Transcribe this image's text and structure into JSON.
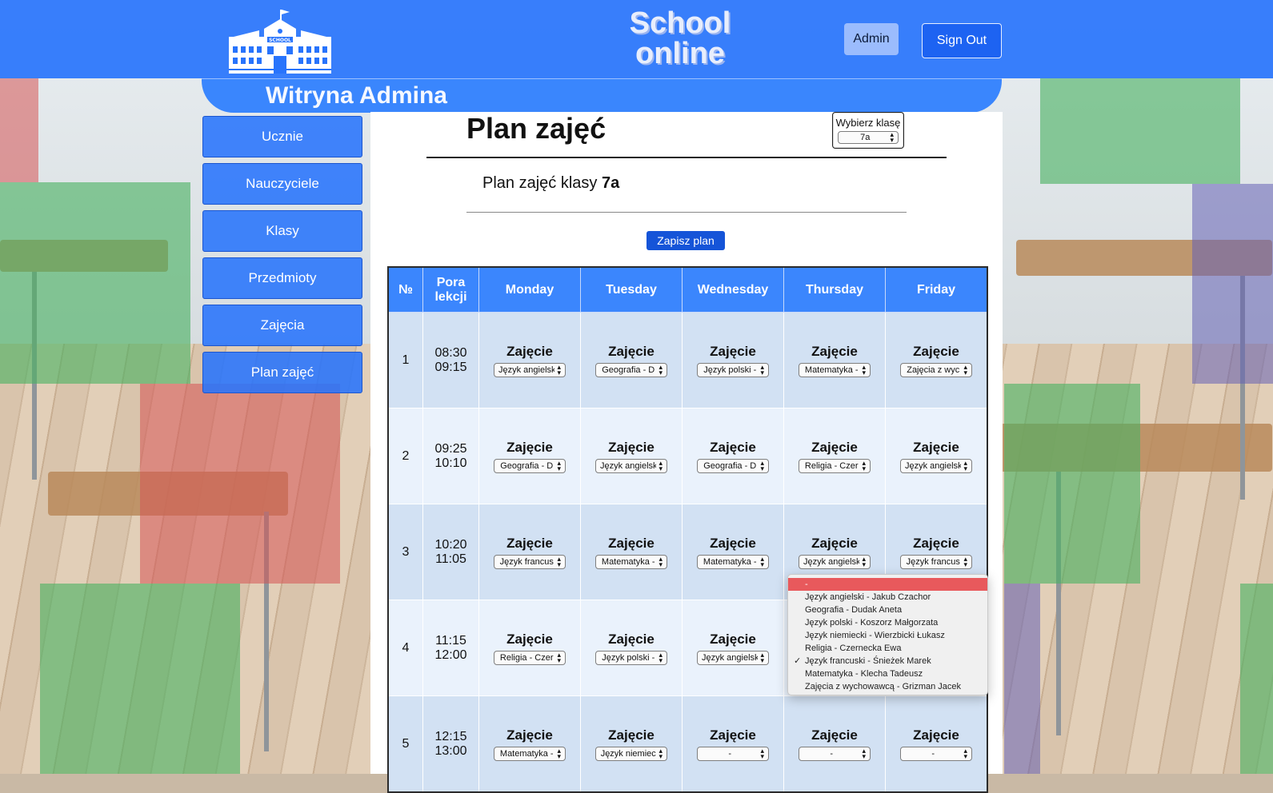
{
  "header": {
    "brand_line1": "School",
    "brand_line2": "online",
    "admin_label": "Admin",
    "signout_label": "Sign Out",
    "logo_sign": "SCHOOL"
  },
  "subbar": {
    "title": "Witryna Admina"
  },
  "nav": [
    "Ucznie",
    "Nauczyciele",
    "Klasy",
    "Przedmioty",
    "Zajęcia",
    "Plan zajęć"
  ],
  "main": {
    "title": "Plan zajęć",
    "class_select_label": "Wybierz klasę",
    "class_selected": "7a",
    "subtitle_prefix": "Plan zajęć klasy ",
    "subtitle_class": "7a",
    "save_label": "Zapisz plan"
  },
  "table": {
    "headers": [
      "№",
      "Pora lekcji",
      "Monday",
      "Tuesday",
      "Wednesday",
      "Thursday",
      "Friday"
    ],
    "cell_label": "Zajęcie",
    "rows": [
      {
        "num": "1",
        "start": "08:30",
        "end": "09:15",
        "cells": [
          "Język angielski",
          "Geografia - D",
          "Język polski -",
          "Matematyka -",
          "Zajęcia z wyc"
        ]
      },
      {
        "num": "2",
        "start": "09:25",
        "end": "10:10",
        "cells": [
          "Geografia - D",
          "Język angielski",
          "Geografia - D",
          "Religia - Czer",
          "Język angielski"
        ]
      },
      {
        "num": "3",
        "start": "10:20",
        "end": "11:05",
        "cells": [
          "Język francus",
          "Matematyka -",
          "Matematyka -",
          "Język angielski",
          "Język francus"
        ]
      },
      {
        "num": "4",
        "start": "11:15",
        "end": "12:00",
        "cells": [
          "Religia - Czer",
          "Język polski -",
          "Język angielski",
          "",
          ""
        ]
      },
      {
        "num": "5",
        "start": "12:15",
        "end": "13:00",
        "cells": [
          "Matematyka -",
          "Język niemiec",
          "-",
          "-",
          "-"
        ]
      }
    ]
  },
  "dropdown": {
    "options": [
      "-",
      "Język angielski - Jakub Czachor",
      "Geografia - Dudak Aneta",
      "Język polski - Koszorz Małgorzata",
      "Język niemiecki - Wierzbicki Łukasz",
      "Religia - Czernecka Ewa",
      "Język francuski - Śnieżek Marek",
      "Matematyka - Klecha Tadeusz",
      "Zajęcia z wychowawcą - Grizman Jacek"
    ],
    "highlighted_index": 0,
    "checked_index": 6,
    "check_glyph": "✓"
  },
  "colors": {
    "header": "#2874fc",
    "accent": "#3b86fd",
    "save": "#1554d8",
    "highlight": "#e8595c"
  },
  "icons": {
    "select_arrows": "⬍",
    "logo": "school-building-icon"
  }
}
